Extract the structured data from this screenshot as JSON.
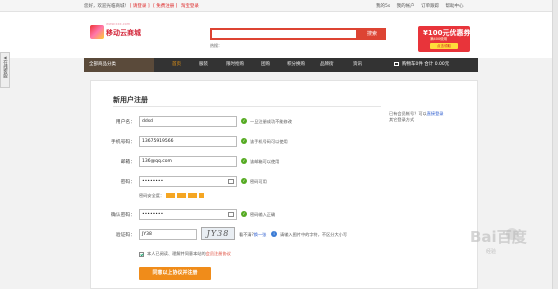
{
  "topbar": {
    "welcome": "您好，欢迎光临商城!",
    "login": "[ 请登录 ]",
    "register": "[ 免费注册 ]",
    "taobao": "淘宝登录",
    "links": [
      "我的5s",
      "我的帐户",
      "订单跟踪",
      "帮助中心"
    ]
  },
  "header": {
    "logo_text": "移动云商城",
    "logo_sub": "www.xxx.com",
    "search_button": "搜索",
    "hot_label": "热搜：",
    "coupon_amount": "¥100元优惠券",
    "coupon_condition": "满400使用",
    "coupon_button": "点击领取"
  },
  "side_tab": {
    "label": "在线客服"
  },
  "nav": {
    "category": "全部商品分类",
    "items": [
      "首页",
      "服装",
      "限时抢购",
      "团购",
      "积分换购",
      "品牌街",
      "资讯"
    ],
    "active_index": 0,
    "cart": "购物车0件 合计 0.00元"
  },
  "form": {
    "title": "新用户注册",
    "fields": [
      {
        "label": "用户名：",
        "value": "ddsd",
        "hint": "一旦注册成功不能修改"
      },
      {
        "label": "手机号码：",
        "value": "13675919566",
        "hint": "该手机号码可以使用"
      },
      {
        "label": "邮箱：",
        "value": "136@qq.com",
        "hint": "该邮箱可以使用"
      },
      {
        "label": "密码：",
        "value": "••••••••",
        "hint": "密码可用"
      },
      {
        "label": "确认密码：",
        "value": "••••••••",
        "hint": "密码输入正确"
      },
      {
        "label": "验证码：",
        "value": "JY38",
        "hint": "请输入图片中的字符，不区分大小写"
      }
    ],
    "strength_label": "密码安全度：",
    "captcha_text": "JY38",
    "refresh_text": "看不清?",
    "refresh_link": "换一张",
    "agree_text": "本人已阅读、理解并同意本站的",
    "agree_link": "会员注册协议",
    "submit_label": "同意以上协议并注册"
  },
  "aside": {
    "line1": "已有会员帐号？可以",
    "login_link": "直接登录",
    "line2": "其它登录方式"
  },
  "watermark": {
    "brand": "Bai百度",
    "sub": "经验"
  }
}
